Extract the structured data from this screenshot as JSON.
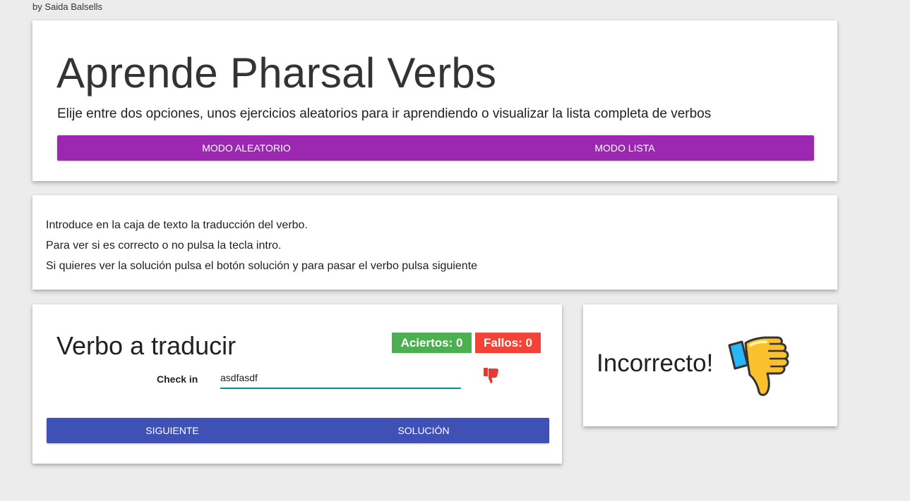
{
  "byline": "by Saida Balsells",
  "header": {
    "title": "Aprende Pharsal Verbs",
    "subtitle": "Elije entre dos opciones, unos ejercicios aleatorios para ir aprendiendo o visualizar la lista completa de verbos",
    "random_mode_label": "MODO ALEATORIO",
    "list_mode_label": "MODO LISTA"
  },
  "instructions": {
    "lines": [
      "Introduce en la caja de texto la traducción del verbo.",
      "Para ver si es correcto o no pulsa la tecla intro.",
      "Si quieres ver la solución pulsa el botón solución y para pasar el verbo pulsa siguiente"
    ]
  },
  "exercise": {
    "title": "Verbo a traducir",
    "hits_badge": "Aciertos: 0",
    "misses_badge": "Fallos: 0",
    "verb": "Check in",
    "answer_value": "asdfasdf",
    "next_label": "SIGUIENTE",
    "solution_label": "SOLUCIÓN",
    "status_icon": "thumbs-down-icon"
  },
  "result": {
    "text": "Incorrecto!",
    "icon": "thumbs-down-icon"
  },
  "colors": {
    "mode_bar": "#9c27b0",
    "action_bar": "#3f51b5",
    "hits": "#4caf50",
    "misses": "#f44336",
    "input_underline": "#009688"
  }
}
